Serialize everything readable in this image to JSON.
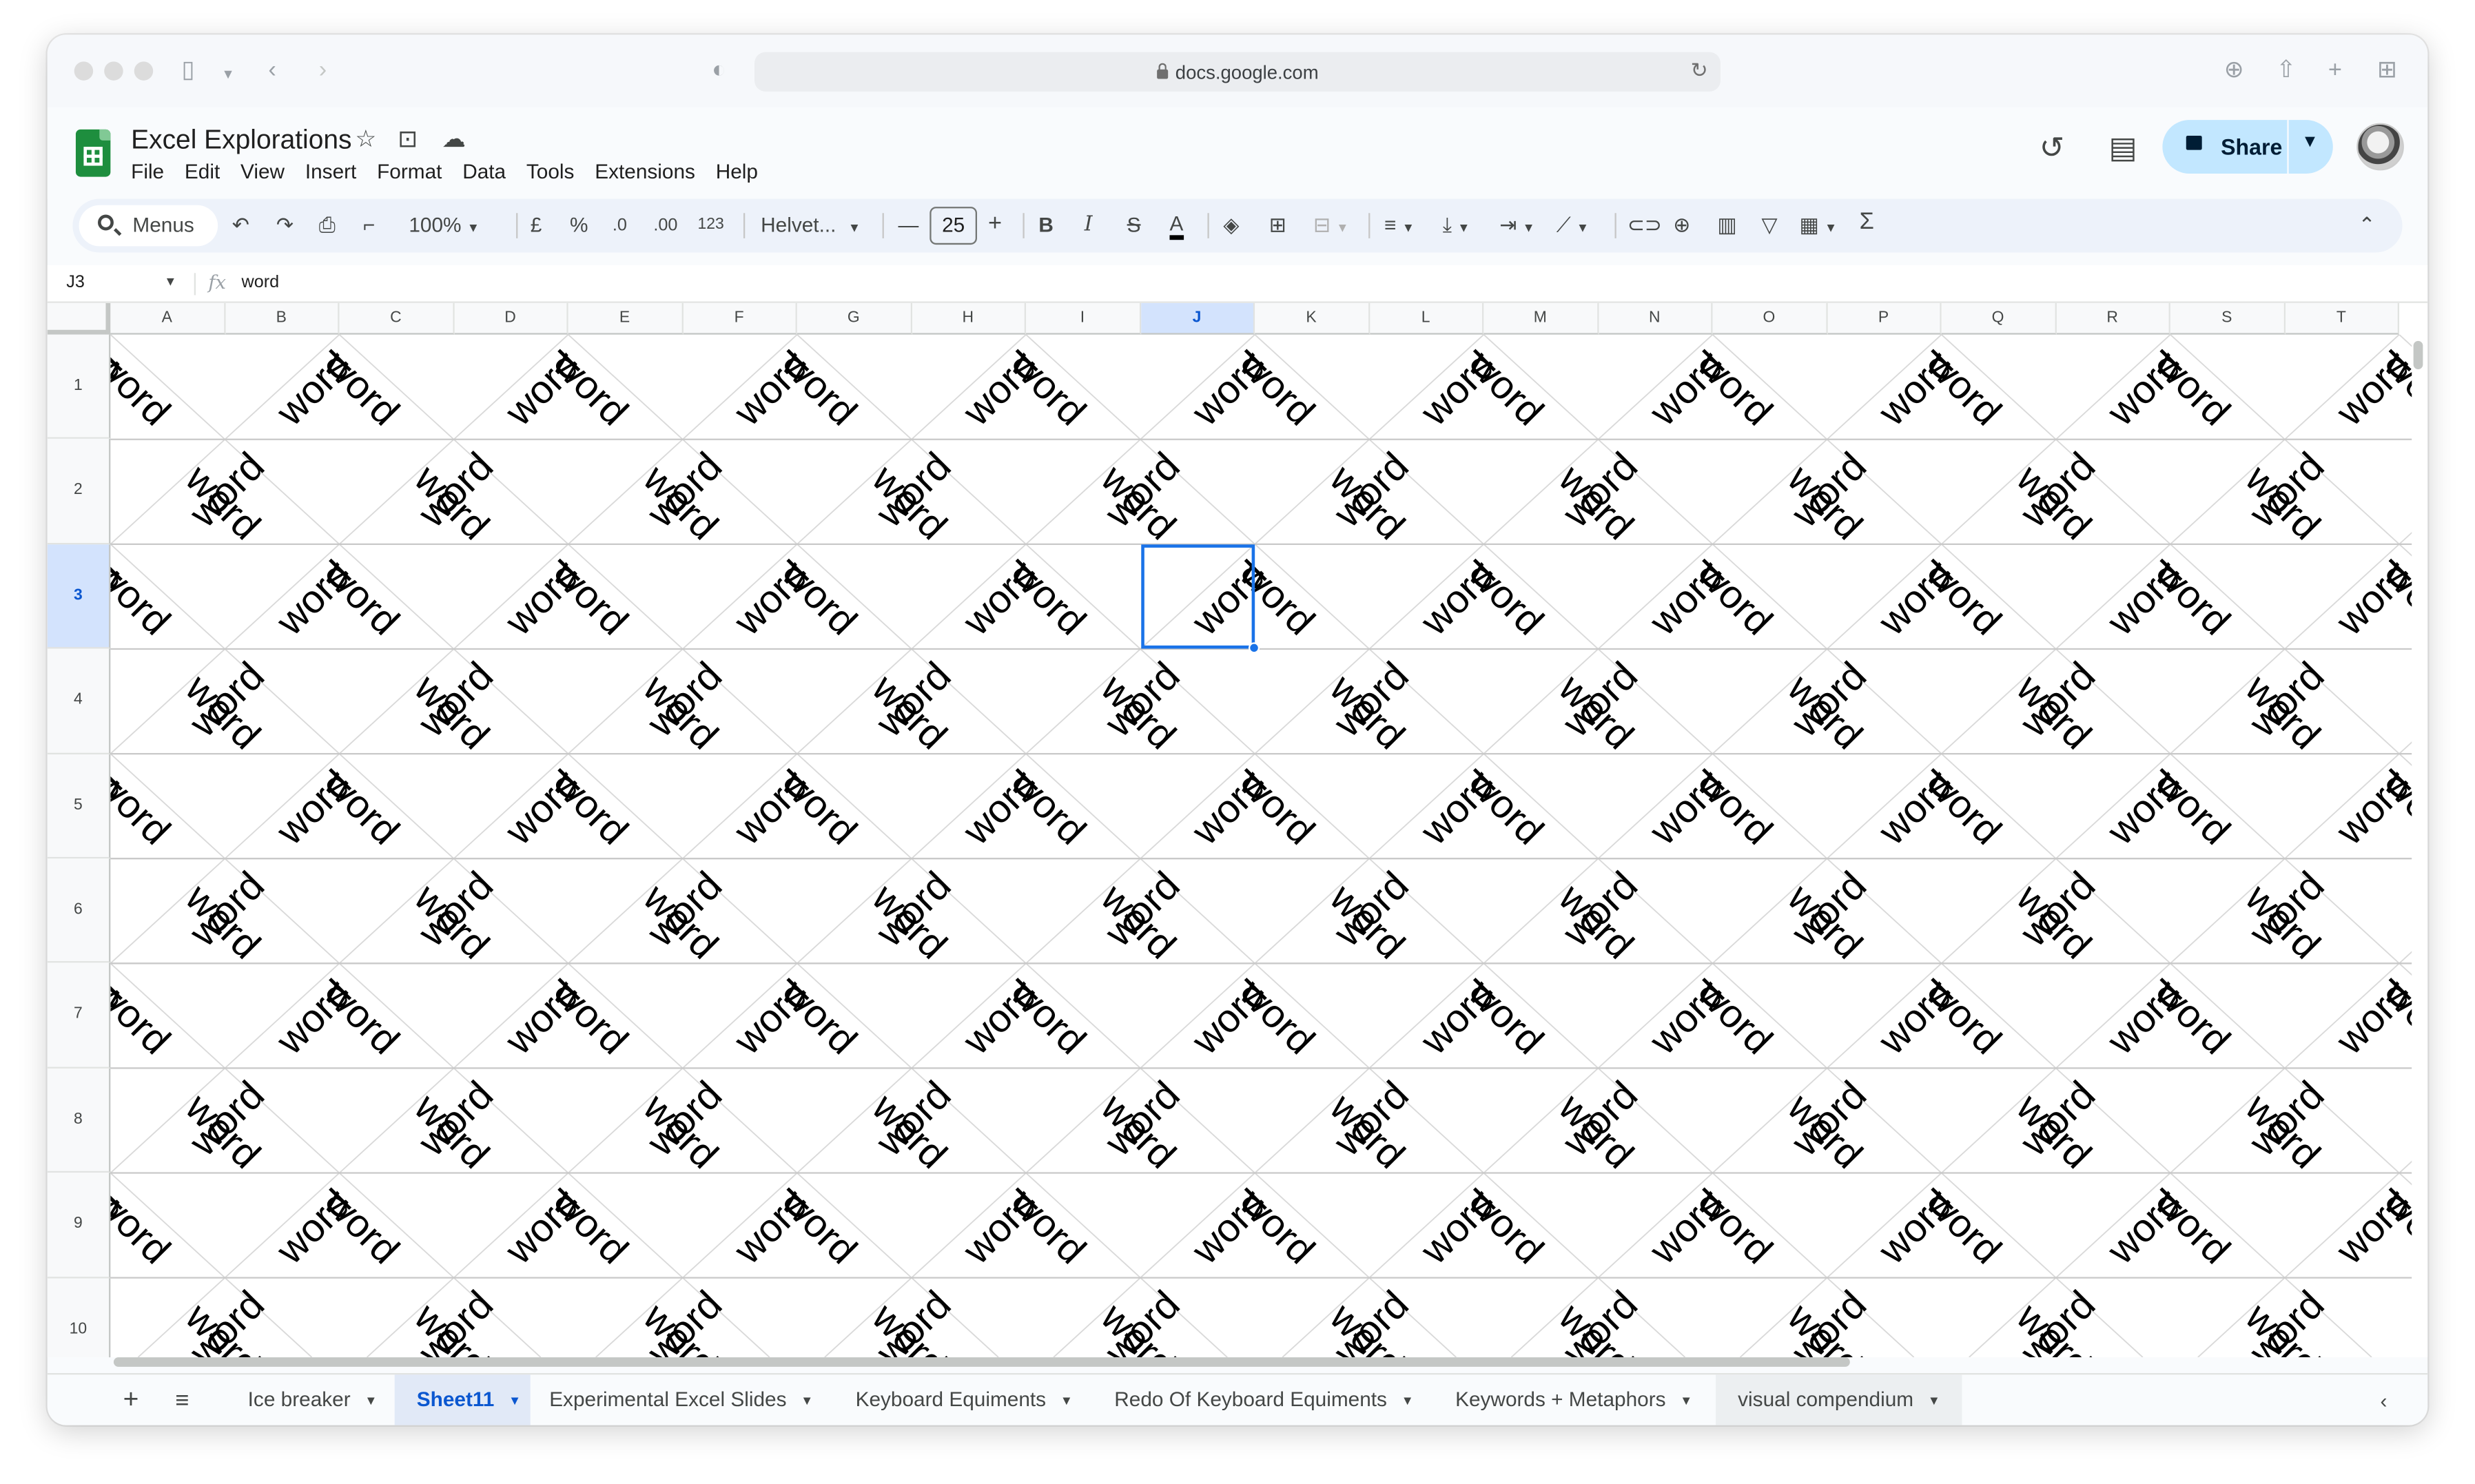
{
  "browser": {
    "url": "docs.google.com"
  },
  "app": {
    "title": "Excel Explorations",
    "menus": [
      "File",
      "Edit",
      "View",
      "Insert",
      "Format",
      "Data",
      "Tools",
      "Extensions",
      "Help"
    ],
    "share_label": "Share"
  },
  "toolbar": {
    "search_menus": "Menus",
    "zoom": "100%",
    "currency": "£",
    "percent": "%",
    "dec_decrease": ".0",
    "dec_increase": ".00",
    "number_format": "123",
    "font": "Helvet...",
    "font_size": "25",
    "bold": "B",
    "italic": "I",
    "strike": "S",
    "text_color": "A",
    "sigma": "Σ"
  },
  "formula_bar": {
    "cell_ref": "J3",
    "fx": "fx",
    "value": "word"
  },
  "sheet": {
    "columns": [
      "A",
      "B",
      "C",
      "D",
      "E",
      "F",
      "G",
      "H",
      "I",
      "J",
      "K",
      "L",
      "M",
      "N",
      "O",
      "P",
      "Q",
      "R",
      "S",
      "T"
    ],
    "rows": [
      "1",
      "2",
      "3",
      "4",
      "5",
      "6",
      "7",
      "8",
      "9",
      "10"
    ],
    "cell_text": "word",
    "selected_cell": "J3",
    "selected_col": "J",
    "selected_row": "3"
  },
  "tabs": [
    {
      "label": "Ice breaker",
      "active": false
    },
    {
      "label": "Sheet11",
      "active": true
    },
    {
      "label": "Experimental Excel Slides",
      "active": false
    },
    {
      "label": "Keyboard Equiments",
      "active": false
    },
    {
      "label": "Redo Of Keyboard Equiments",
      "active": false
    },
    {
      "label": "Keywords + Metaphors",
      "active": false
    },
    {
      "label": "visual compendium",
      "active": false
    }
  ],
  "colors": {
    "accent": "#0b57d0",
    "selection": "#1a73e8",
    "share_bg": "#c2e7ff",
    "sheets_green": "#1e8e3e"
  }
}
